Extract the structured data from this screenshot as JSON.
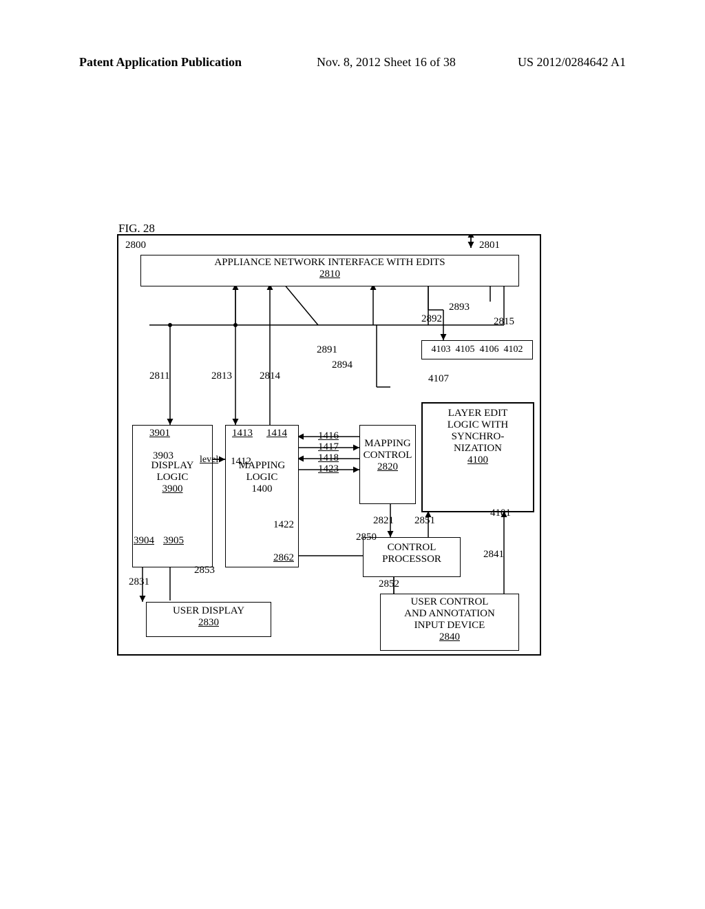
{
  "header": {
    "left": "Patent Application Publication",
    "mid": "Nov. 8, 2012   Sheet 16 of 38",
    "right": "US 2012/0284642 A1"
  },
  "fig_label": "FIG. 28",
  "boxes": {
    "appliance": {
      "line1": "APPLIANCE NETWORK INTERFACE WITH EDITS",
      "num": "2810"
    },
    "display_logic": {
      "line1": "DISPLAY",
      "line2": "LOGIC",
      "num": "3900"
    },
    "mapping_logic": {
      "line1": "MAPPING",
      "line2": "LOGIC",
      "num": "1400"
    },
    "mapping_control": {
      "line1": "MAPPING",
      "line2": "CONTROL",
      "num": "2820"
    },
    "layer_edit": {
      "line1": "LAYER EDIT",
      "line2": "LOGIC WITH",
      "line3": "SYNCHRO-",
      "line4": "NIZATION",
      "num": "4100"
    },
    "control_processor": {
      "line1": "CONTROL",
      "line2": "PROCESSOR"
    },
    "user_display": {
      "line1": "USER  DISPLAY",
      "num": "2830"
    },
    "user_control": {
      "line1": "USER CONTROL",
      "line2": "AND ANNOTATION",
      "line3": "INPUT DEVICE",
      "num": "2840"
    }
  },
  "nums": {
    "n2800": "2800",
    "n2801": "2801",
    "n2811": "2811",
    "n2813": "2813",
    "n2814": "2814",
    "n2815": "2815",
    "n2891": "2891",
    "n2892": "2892",
    "n2893": "2893",
    "n2894": "2894",
    "n3901": "3901",
    "n3903": "3903",
    "n3904": "3904",
    "n3905": "3905",
    "n1412": "1412",
    "n1413": "1413",
    "n1414": "1414",
    "n1416": "1416",
    "n1417": "1417",
    "n1418": "1418",
    "n1423": "1423",
    "n1422": "1422",
    "n2821": "2821",
    "n2850": "2850",
    "n2851": "2851",
    "n2852": "2852",
    "n2853": "2853",
    "n2862": "2862",
    "n2841": "2841",
    "n2831": "2831",
    "n4101": "4101",
    "n4102": "4102",
    "n4103": "4103",
    "n4105": "4105",
    "n4106": "4106",
    "n4107": "4107",
    "level": "level"
  }
}
